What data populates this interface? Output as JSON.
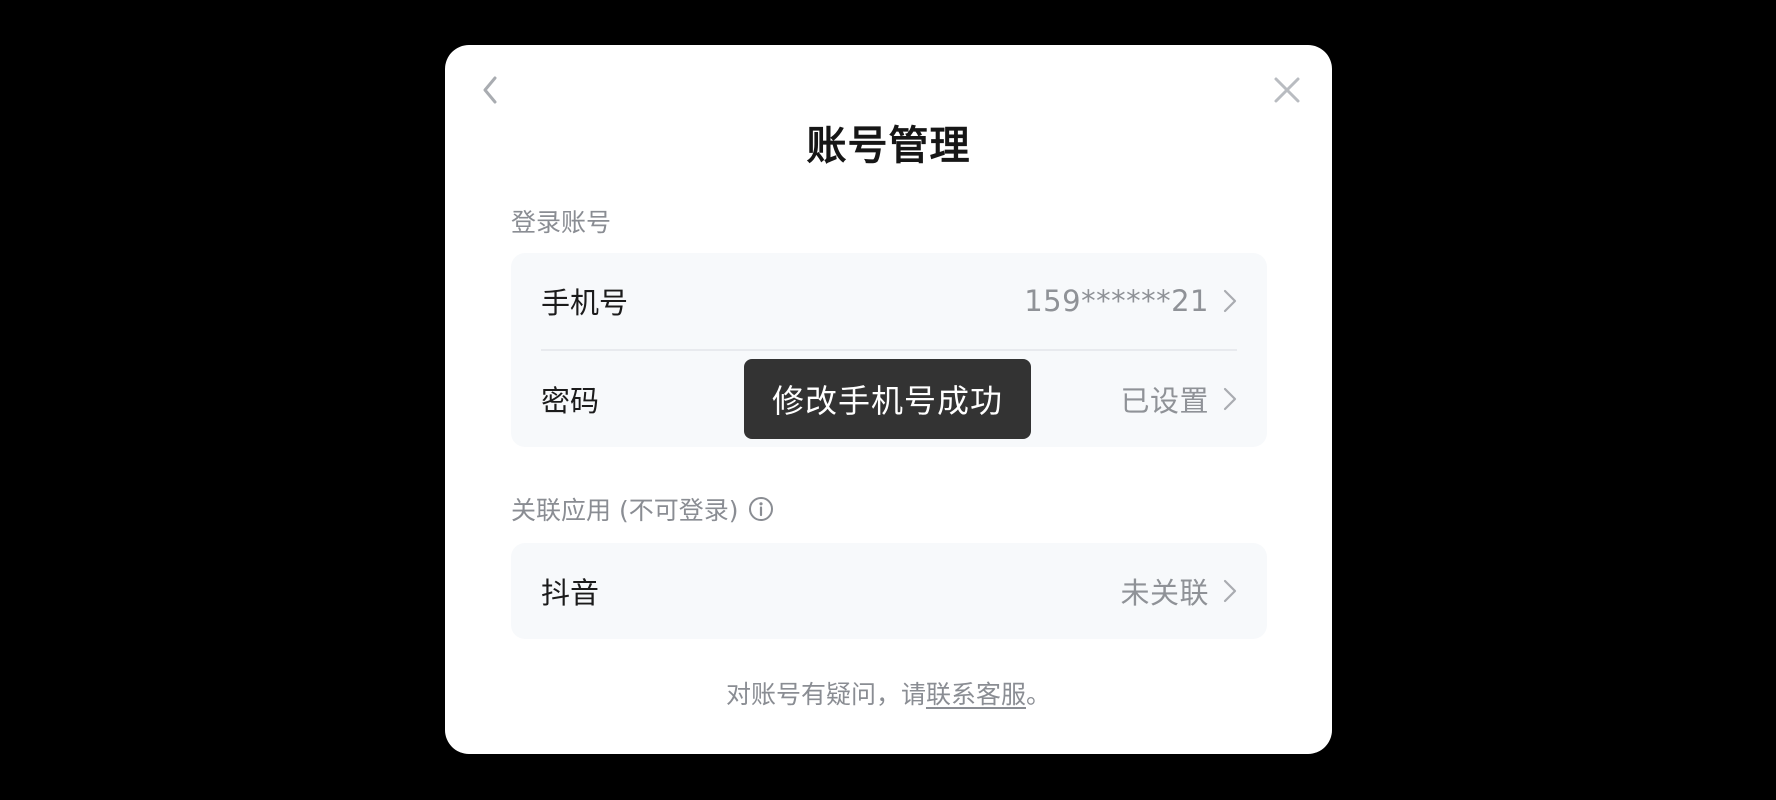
{
  "dialog": {
    "title": "账号管理",
    "back_icon": "chevron-left-icon",
    "close_icon": "close-icon"
  },
  "login_section": {
    "label": "登录账号",
    "rows": [
      {
        "label": "手机号",
        "value": "159******21"
      },
      {
        "label": "密码",
        "value": "已设置"
      }
    ]
  },
  "linked_section": {
    "label": "关联应用 (不可登录)",
    "info_icon": "info-icon",
    "rows": [
      {
        "label": "抖音",
        "value": "未关联"
      }
    ]
  },
  "footer": {
    "text": "对账号有疑问，请",
    "link": "联系客服",
    "suffix": "。"
  },
  "toast": {
    "message": "修改手机号成功"
  },
  "colors": {
    "overlay": "#000000",
    "dialog_bg": "#ffffff",
    "card_bg": "#f7f9fb",
    "toast_bg": "#333333"
  }
}
